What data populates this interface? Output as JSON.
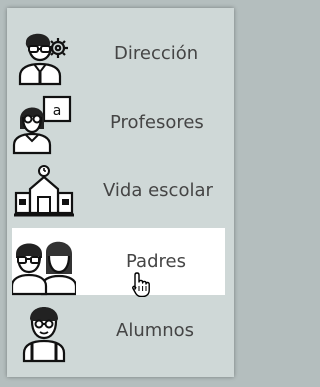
{
  "menu": {
    "items": [
      {
        "label": "Dirección",
        "icon": "director-icon"
      },
      {
        "label": "Profesores",
        "icon": "teacher-icon"
      },
      {
        "label": "Vida escolar",
        "icon": "school-building-icon"
      },
      {
        "label": "Padres",
        "icon": "parents-icon",
        "active": true
      },
      {
        "label": "Alumnos",
        "icon": "student-icon"
      }
    ]
  },
  "colors": {
    "background": "#b4bebe",
    "panel": "#cfd8d7",
    "active_row": "#ffffff",
    "text": "#454545"
  }
}
